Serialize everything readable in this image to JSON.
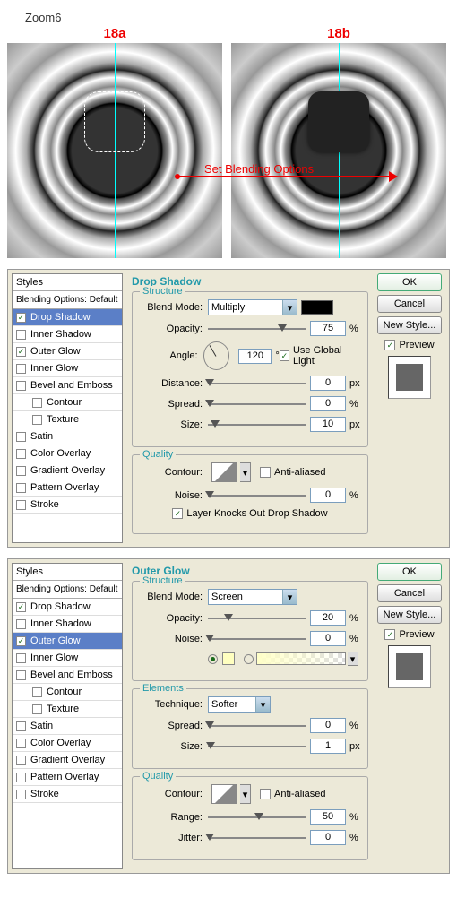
{
  "top_label": "Zoom6",
  "img_labels": {
    "a": "18a",
    "b": "18b"
  },
  "arrow_text": "Set Blending Options",
  "styles": {
    "header": "Styles",
    "sub": "Blending Options: Default",
    "items": [
      {
        "label": "Drop Shadow",
        "checked": true
      },
      {
        "label": "Inner Shadow",
        "checked": false
      },
      {
        "label": "Outer Glow",
        "checked": true
      },
      {
        "label": "Inner Glow",
        "checked": false
      },
      {
        "label": "Bevel and Emboss",
        "checked": false
      },
      {
        "label": "Contour",
        "checked": false,
        "indent": true
      },
      {
        "label": "Texture",
        "checked": false,
        "indent": true
      },
      {
        "label": "Satin",
        "checked": false
      },
      {
        "label": "Color Overlay",
        "checked": false
      },
      {
        "label": "Gradient Overlay",
        "checked": false
      },
      {
        "label": "Pattern Overlay",
        "checked": false
      },
      {
        "label": "Stroke",
        "checked": false
      }
    ]
  },
  "buttons": {
    "ok": "OK",
    "cancel": "Cancel",
    "new_style": "New Style...",
    "preview": "Preview"
  },
  "panel1": {
    "title": "Drop Shadow",
    "structure_title": "Structure",
    "blend_label": "Blend Mode:",
    "blend_value": "Multiply",
    "opacity_label": "Opacity:",
    "opacity_value": "75",
    "opacity_unit": "%",
    "angle_label": "Angle:",
    "angle_value": "120",
    "angle_unit": "°",
    "global_light": "Use Global Light",
    "distance_label": "Distance:",
    "distance_value": "0",
    "distance_unit": "px",
    "spread_label": "Spread:",
    "spread_value": "0",
    "spread_unit": "%",
    "size_label": "Size:",
    "size_value": "10",
    "size_unit": "px",
    "quality_title": "Quality",
    "contour_label": "Contour:",
    "aa_label": "Anti-aliased",
    "noise_label": "Noise:",
    "noise_value": "0",
    "noise_unit": "%",
    "knockout": "Layer Knocks Out Drop Shadow"
  },
  "panel2": {
    "title": "Outer Glow",
    "structure_title": "Structure",
    "blend_label": "Blend Mode:",
    "blend_value": "Screen",
    "opacity_label": "Opacity:",
    "opacity_value": "20",
    "opacity_unit": "%",
    "noise_label": "Noise:",
    "noise_value": "0",
    "noise_unit": "%",
    "elements_title": "Elements",
    "technique_label": "Technique:",
    "technique_value": "Softer",
    "spread_label": "Spread:",
    "spread_value": "0",
    "spread_unit": "%",
    "size_label": "Size:",
    "size_value": "1",
    "size_unit": "px",
    "quality_title": "Quality",
    "contour_label": "Contour:",
    "aa_label": "Anti-aliased",
    "range_label": "Range:",
    "range_value": "50",
    "range_unit": "%",
    "jitter_label": "Jitter:",
    "jitter_value": "0",
    "jitter_unit": "%"
  }
}
